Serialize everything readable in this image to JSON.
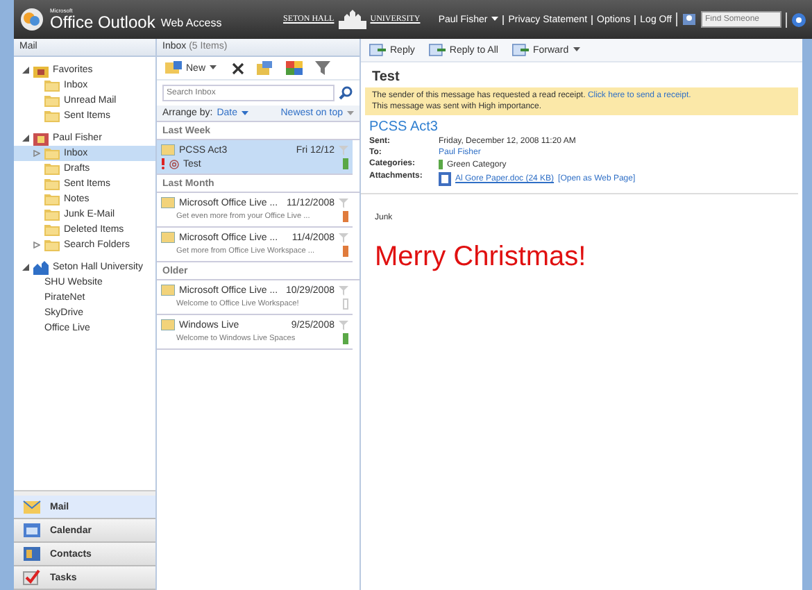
{
  "header": {
    "brand_small": "Microsoft",
    "brand": "Office Outlook",
    "brand_suffix": "Web Access",
    "university_left": "SETON HALL",
    "university_right": "UNIVERSITY",
    "user": "Paul Fisher",
    "links": [
      "Privacy Statement",
      "Options",
      "Log Off"
    ],
    "search": {
      "placeholder": "Find Someone"
    }
  },
  "sidebar": {
    "title": "Mail",
    "groups": [
      {
        "label": "Favorites",
        "expanded": true,
        "kind": "favorites",
        "children": [
          {
            "label": "Inbox",
            "selected": false
          },
          {
            "label": "Unread Mail",
            "selected": false
          },
          {
            "label": "Sent Items",
            "selected": false
          }
        ]
      },
      {
        "label": "Paul Fisher",
        "expanded": true,
        "kind": "mailbox",
        "children": [
          {
            "label": "Inbox",
            "selected": true,
            "expanded": false
          },
          {
            "label": "Drafts",
            "selected": false
          },
          {
            "label": "Sent Items",
            "selected": false
          },
          {
            "label": "Notes",
            "selected": false
          },
          {
            "label": "Junk E-Mail",
            "selected": false
          },
          {
            "label": "Deleted Items",
            "selected": false
          },
          {
            "label": "Search Folders",
            "selected": false,
            "expanded": false
          }
        ]
      },
      {
        "label": "Seton Hall University",
        "expanded": true,
        "kind": "links",
        "children": [
          {
            "label": "SHU Website",
            "selected": false
          },
          {
            "label": "PirateNet",
            "selected": false
          },
          {
            "label": "SkyDrive",
            "selected": false
          },
          {
            "label": "Office Live",
            "selected": false
          }
        ]
      }
    ],
    "nav": [
      {
        "label": "Mail",
        "selected": true,
        "kind": "mail"
      },
      {
        "label": "Calendar",
        "selected": false,
        "kind": "calendar"
      },
      {
        "label": "Contacts",
        "selected": false,
        "kind": "contacts"
      },
      {
        "label": "Tasks",
        "selected": false,
        "kind": "tasks"
      }
    ]
  },
  "message_list": {
    "title": "Inbox",
    "count": "(5 Items)",
    "new_button": "New",
    "search": {
      "placeholder": "Search Inbox"
    },
    "arrange_label": "Arrange by:",
    "arrange_value": "Date",
    "sort": "Newest on top",
    "groups": [
      {
        "label": "Last Week",
        "messages": [
          {
            "sender": "PCSS Act3",
            "date": "Fri 12/12",
            "preview": "Test",
            "selected": true,
            "important": true,
            "color": "#5aa847"
          }
        ]
      },
      {
        "label": "Last Month",
        "messages": [
          {
            "sender": "Microsoft Office Live ...",
            "date": "11/12/2008",
            "preview": "Get even more from your Office Live ...",
            "selected": false,
            "important": false,
            "color": "#e07b3c"
          },
          {
            "sender": "Microsoft Office Live ...",
            "date": "11/4/2008",
            "preview": "Get more from Office Live Workspace ...",
            "selected": false,
            "important": false,
            "color": "#e07b3c"
          }
        ]
      },
      {
        "label": "Older",
        "messages": [
          {
            "sender": "Microsoft Office Live ...",
            "date": "10/29/2008",
            "preview": "Welcome to Office Live Workspace!",
            "selected": false,
            "important": false
          },
          {
            "sender": "Windows Live",
            "date": "9/25/2008",
            "preview": "Welcome to Windows Live Spaces",
            "selected": false,
            "important": false,
            "color": "#5aa847"
          }
        ]
      }
    ]
  },
  "reading_pane": {
    "toolbar": [
      "Reply",
      "Reply to All",
      "Forward"
    ],
    "subject": "Test",
    "infobar": {
      "text": "The sender of this message has requested a read receipt.",
      "link": "Click here to send a receipt.",
      "note": "This message was sent with High importance."
    },
    "from": "PCSS Act3",
    "fields": [
      {
        "label": "Sent:",
        "value": "Friday, December 12, 2008 11:20 AM",
        "kind": "text"
      },
      {
        "label": "To:",
        "value": "Paul Fisher",
        "kind": "link"
      },
      {
        "label": "Categories:",
        "value": "Green Category",
        "kind": "category",
        "color": "#5aa847"
      },
      {
        "label": "Attachments:",
        "value": "Al Gore Paper.doc (24 KB)",
        "extra": "[Open as Web Page]",
        "kind": "attachment"
      }
    ],
    "body": [
      "Junk",
      "Merry Christmas!"
    ]
  }
}
